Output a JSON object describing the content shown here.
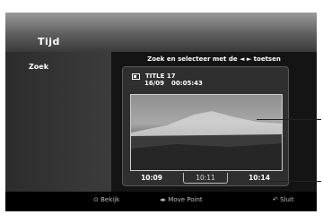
{
  "menu_title": "Tijd",
  "sidebar": {
    "items": [
      {
        "label": "Zoek"
      }
    ]
  },
  "instruction": "Zoek en selecteer met de ◄ ► toetsen",
  "title_info": {
    "title": "TITLE 17",
    "date": "16/09",
    "duration": "00:05:43"
  },
  "timeline": {
    "times": [
      "10:09",
      "10:11",
      "10:14"
    ],
    "selected_index": 1
  },
  "footer": {
    "view": {
      "icon": "circle-button-icon",
      "label": "Bekijk"
    },
    "move": {
      "icon": "left-right-arrows-icon",
      "label": "Move Point"
    },
    "close": {
      "icon": "return-icon",
      "label": "Sluit"
    }
  }
}
